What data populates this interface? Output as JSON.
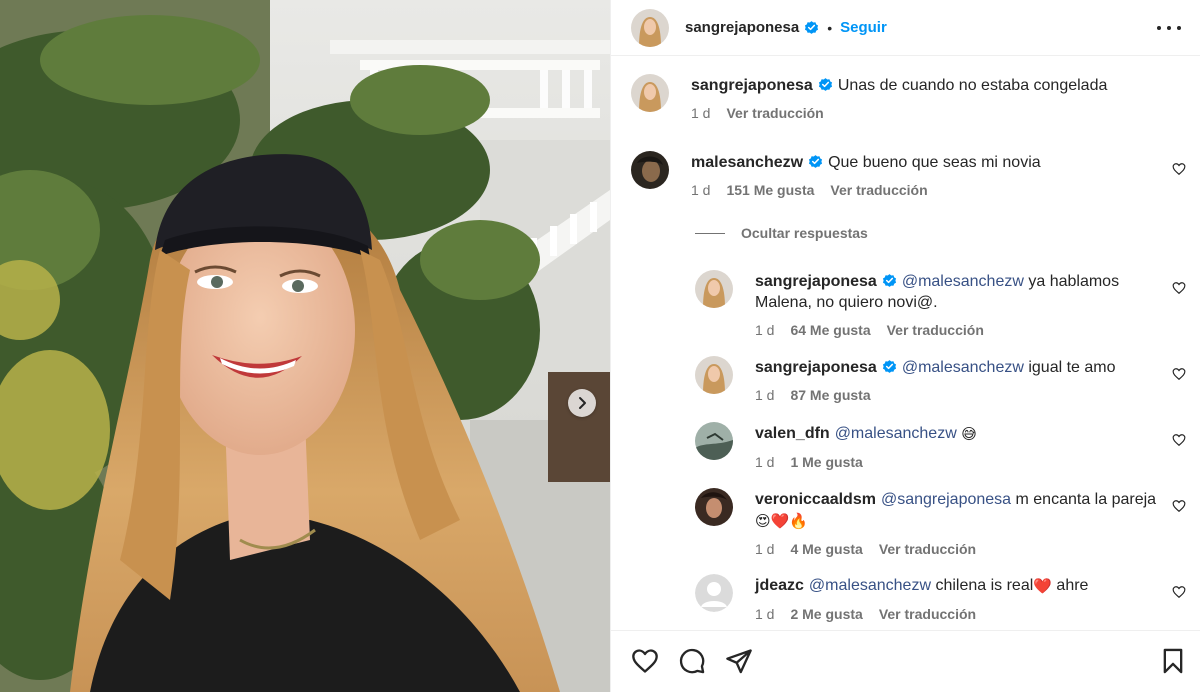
{
  "post": {
    "author": "sangrejaponesa",
    "follow_label": "Seguir",
    "dot": "•"
  },
  "caption": {
    "username": "sangrejaponesa",
    "text": "Unas de cuando no estaba congelada",
    "time": "1 d",
    "translate": "Ver traducción"
  },
  "comment": {
    "username": "malesanchezw",
    "text": "Que bueno que seas mi novia",
    "time": "1 d",
    "likes": "151 Me gusta",
    "translate": "Ver traducción",
    "hide_replies": "Ocultar respuestas"
  },
  "replies": [
    {
      "username": "sangrejaponesa",
      "mention": "@malesanchezw",
      "text": " ya hablamos",
      "text2": "Malena, no quiero novi@.",
      "time": "1 d",
      "likes": "64 Me gusta",
      "translate": "Ver traducción"
    },
    {
      "username": "sangrejaponesa",
      "mention": "@malesanchezw",
      "text": " igual te amo",
      "time": "1 d",
      "likes": "87 Me gusta"
    },
    {
      "username": "valen_dfn",
      "mention": "@malesanchezw",
      "emoji": "😅",
      "time": "1 d",
      "likes": "1 Me gusta"
    },
    {
      "username": "veroniccaaldsm",
      "mention": "@sangrejaponesa",
      "text": " m encanta la pareja",
      "emoji": "😍❤️🔥",
      "time": "1 d",
      "likes": "4 Me gusta",
      "translate": "Ver traducción"
    },
    {
      "username": "jdeazc",
      "mention": "@malesanchezw",
      "text": " chilena is real",
      "emoji": "❤️",
      "text_after": " ahre",
      "time": "1 d",
      "likes": "2 Me gusta",
      "translate": "Ver traducción"
    }
  ],
  "icons": {
    "verified": "verified-badge-icon",
    "like": "heart-icon",
    "comment": "comment-icon",
    "share": "send-icon",
    "save": "bookmark-icon",
    "more": "more-options-icon",
    "next": "chevron-right-icon"
  },
  "colors": {
    "link": "#0095f6",
    "mention": "#385185",
    "muted": "#737373",
    "verified": "#0095f6"
  }
}
